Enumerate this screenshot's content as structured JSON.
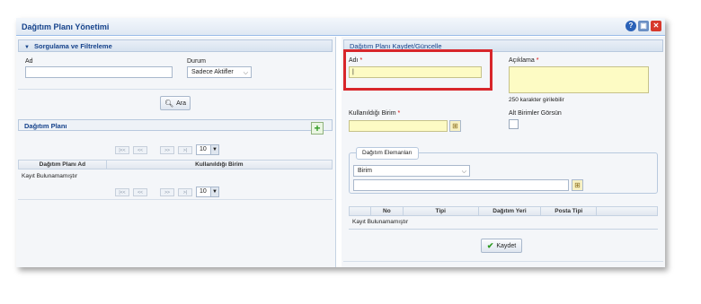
{
  "window": {
    "title": "Dağıtım Planı Yönetimi",
    "icons": [
      "help-icon",
      "image-icon",
      "close-icon"
    ]
  },
  "filter": {
    "section_title": "Sorgulama ve Filtreleme",
    "ad_label": "Ad",
    "ad_value": "",
    "durum_label": "Durum",
    "durum_value": "Sadece Aktifler",
    "search_button": "Ara"
  },
  "plan_list": {
    "section_title": "Dağıtım Planı",
    "page_size": "10",
    "columns": [
      "Dağıtım Planı Ad",
      "Kullanıldığı Birim"
    ],
    "empty_text": "Kayıt Bulunamamıştır",
    "pager_buttons": [
      "|<<",
      "<<",
      ">>",
      ">|"
    ]
  },
  "form": {
    "section_title": "Dağıtım Planı Kaydet/Güncelle",
    "adi_label": "Adı",
    "adi_value": "|",
    "aciklama_label": "Açıklama",
    "char_hint": "250 karakter girilebilir",
    "birim_label": "Kullanıldığı Birim",
    "alt_birimler_label": "Alt Birimler Görsün",
    "required_mark": "*",
    "elements_tab": "Dağıtım Elemanları",
    "element_type_value": "Birim",
    "columns": [
      "No",
      "Tipi",
      "Dağıtım Yeri",
      "Posta Tipi"
    ],
    "empty_text": "Kayıt Bulunamamıştır",
    "save_button": "Kaydet"
  },
  "colors": {
    "highlight": "#d8262b",
    "required_field": "#fdfbc4",
    "title_text": "#15428b"
  }
}
